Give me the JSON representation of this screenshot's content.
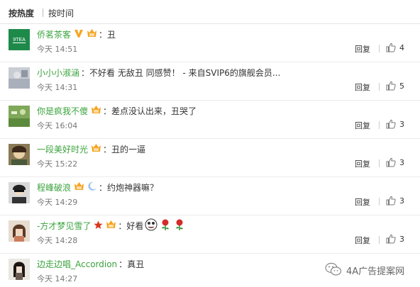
{
  "sort": {
    "hot_label": "按热度",
    "time_label": "按时间"
  },
  "reply_label": "回复",
  "comments": [
    {
      "user": "侨茗茶客",
      "text": "丑",
      "time": "今天 14:51",
      "likes": "4"
    },
    {
      "user": "小小小淑涵",
      "text": "不好看  无敌丑  同感赞！ - 来自SVIP6的旗舰会员...",
      "time": "今天 14:31",
      "likes": "5"
    },
    {
      "user": "你是疯我不傻",
      "text": "差点没认出来，丑哭了",
      "time": "今天 16:04",
      "likes": "3"
    },
    {
      "user": "一段美好时光",
      "text": "丑的一逼",
      "time": "今天 15:22",
      "likes": "3"
    },
    {
      "user": "程峰破浪",
      "text": "约炮神器嘛？",
      "time": "今天 14:29",
      "likes": "3"
    },
    {
      "user": "-方才梦见雪了",
      "text": "好看",
      "time": "今天 14:28",
      "likes": "3"
    },
    {
      "user": "边走边唱_Accordion",
      "text": "真丑",
      "time": "今天 14:27",
      "likes": ""
    }
  ],
  "avatar1_text": "9TEA",
  "watermark": "4A广告提案网",
  "colors": {
    "username": "#3aa33c",
    "badge": "#f5a623",
    "divider": "#ececec"
  }
}
